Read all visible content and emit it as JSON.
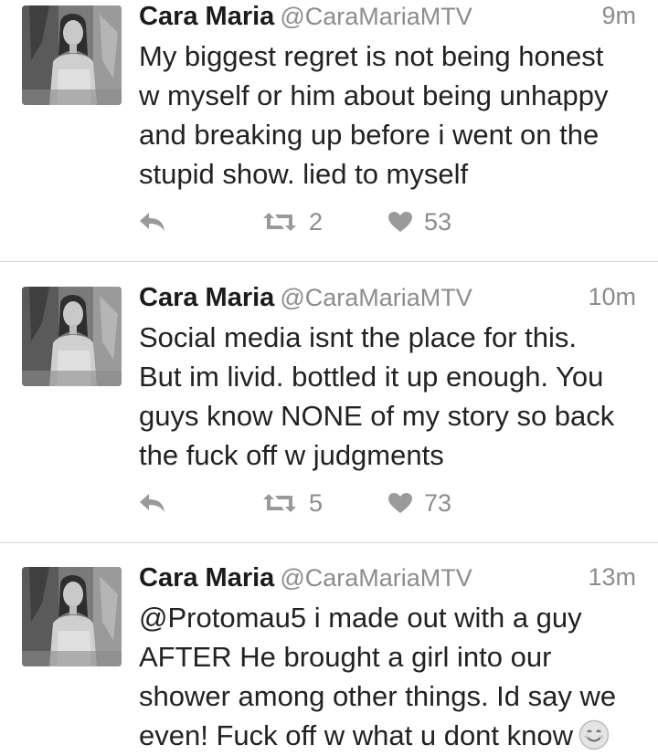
{
  "tweets": [
    {
      "name": "Cara Maria",
      "handle": "@CaraMariaMTV",
      "time": "9m",
      "lines": [
        "My biggest regret is not being honest",
        "w myself or him about being unhappy",
        "and breaking up before i went on the",
        "stupid show. lied to myself"
      ],
      "retweets": "2",
      "likes": "53"
    },
    {
      "name": "Cara Maria",
      "handle": "@CaraMariaMTV",
      "time": "10m",
      "lines": [
        "Social media isnt the place for this.",
        "But im livid. bottled it up enough. You",
        "guys know NONE of my story so back",
        "the fuck off w judgments"
      ],
      "retweets": "5",
      "likes": "73"
    },
    {
      "name": "Cara Maria",
      "handle": "@CaraMariaMTV",
      "time": "13m",
      "lines": [
        "@Protomau5 i made out with a guy",
        "AFTER He brought a girl into our",
        "shower among other things. Id say we",
        "even! Fuck off w what u dont know"
      ],
      "emoji": "smiling-face-emoji"
    }
  ],
  "icons": {
    "reply": "reply-arrow-icon",
    "retweet": "retweet-icon",
    "like": "heart-icon"
  },
  "colors": {
    "name": "#1b1b1b",
    "meta": "#8c8c8c",
    "text": "#222222",
    "icon": "#9a9a9a",
    "divider": "#d6d6d6"
  }
}
